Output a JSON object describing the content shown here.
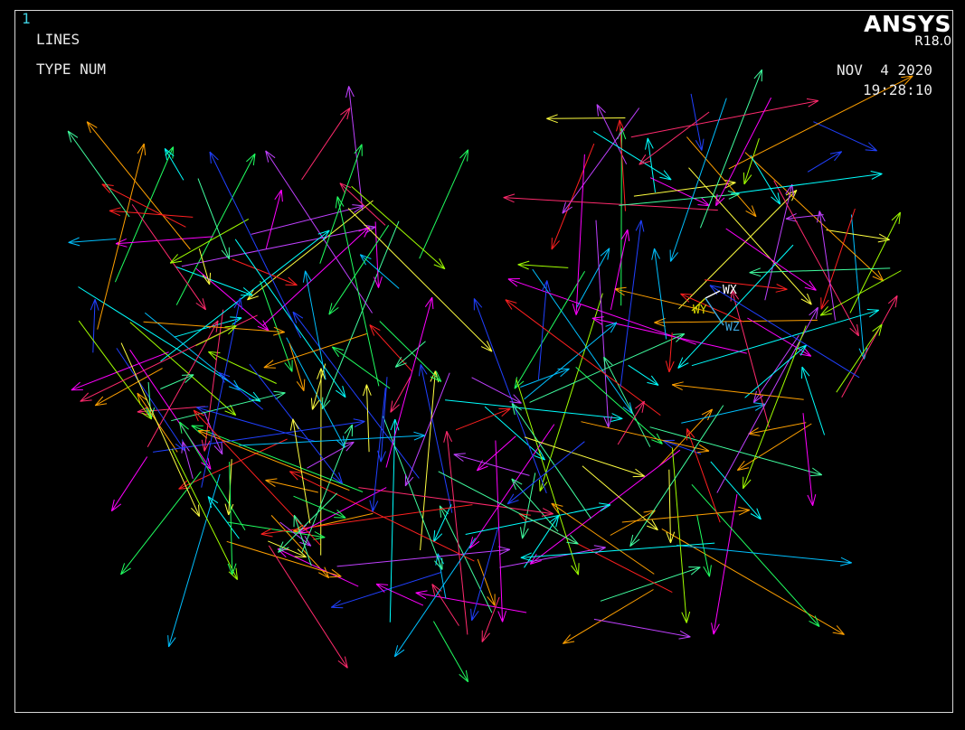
{
  "window": {
    "number": "1",
    "title": "LINES",
    "subtitle": "TYPE NUM"
  },
  "brand": {
    "name": "ANSYS",
    "version": "R18.0"
  },
  "timestamp": {
    "date": "NOV  4 2020",
    "time": "19:28:10"
  },
  "triad": {
    "x_label": "WX",
    "y_label": "WY",
    "z_label": "WZ",
    "x_color": "#ffffff",
    "y_color": "#d6d600",
    "z_color": "#3fa8e0"
  },
  "colors": {
    "background": "#000000",
    "frame": "#d8d8d8",
    "line_palette": [
      "#ff2a6d",
      "#ff00ff",
      "#c040ff",
      "#2040ff",
      "#00c0ff",
      "#00ffff",
      "#20ff60",
      "#a0ff00",
      "#ffff40",
      "#ffa000",
      "#ff2020",
      "#40ffa0"
    ]
  }
}
